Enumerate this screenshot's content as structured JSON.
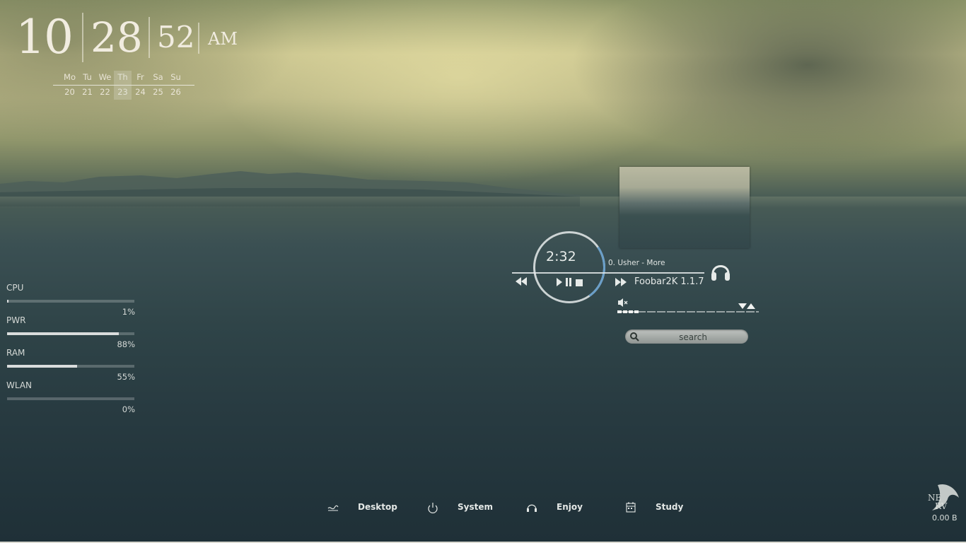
{
  "clock": {
    "hour": "10",
    "minute": "28",
    "second": "52",
    "ampm": "AM"
  },
  "calendar": {
    "days": [
      "Mo",
      "Tu",
      "We",
      "Th",
      "Fr",
      "Sa",
      "Su"
    ],
    "dates": [
      "20",
      "21",
      "22",
      "23",
      "24",
      "25",
      "26"
    ],
    "today_index": 3
  },
  "meters": [
    {
      "label": "CPU",
      "percent_text": "1%",
      "level": 0.01
    },
    {
      "label": "PWR",
      "percent_text": "88%",
      "level": 0.88
    },
    {
      "label": "RAM",
      "percent_text": "55%",
      "level": 0.55
    },
    {
      "label": "WLAN",
      "percent_text": "0%",
      "level": 0.0
    }
  ],
  "player": {
    "time": "2:32",
    "track": "0. Usher - More",
    "app": "Foobar2K 1.1.7",
    "progress": 0.3,
    "volume_level": 0.15,
    "progress_color": "#6a9fc9"
  },
  "search": {
    "placeholder": "search"
  },
  "dock": {
    "items": [
      {
        "label": "Desktop",
        "icon": "desktop-wave-icon"
      },
      {
        "label": "System",
        "icon": "system-power-icon"
      },
      {
        "label": "Enjoy",
        "icon": "enjoy-headphones-icon"
      },
      {
        "label": "Study",
        "icon": "study-calendar-icon"
      }
    ]
  },
  "network": {
    "value": "0.00 B"
  },
  "logo": {
    "text": "NERV"
  }
}
